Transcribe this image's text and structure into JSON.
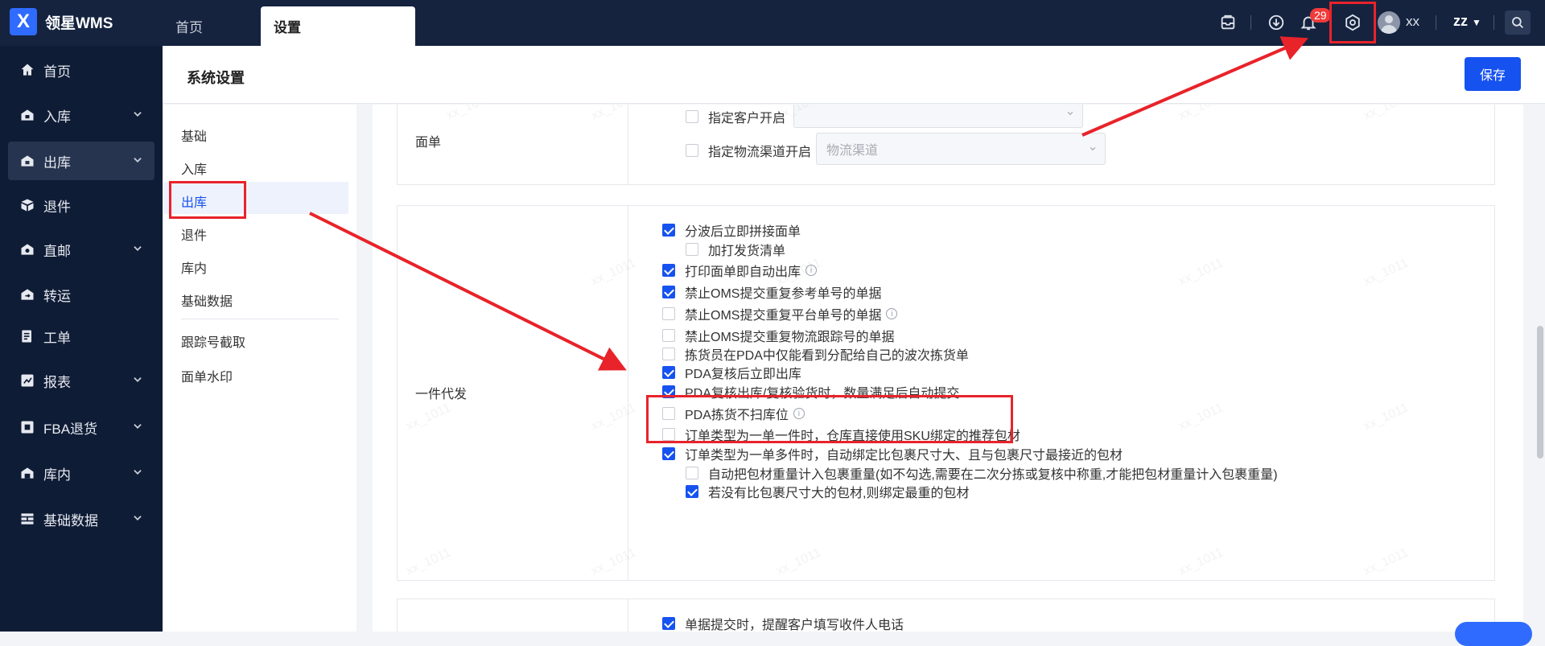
{
  "app": {
    "logo_mark": "X",
    "name": "领星WMS"
  },
  "top_tabs": [
    {
      "label": "首页"
    },
    {
      "label": "设置"
    }
  ],
  "topbar": {
    "notification_count": "29",
    "user_name": "xx",
    "org": "zz",
    "icons": [
      "inbox-icon",
      "download-icon",
      "bell-icon",
      "settings-icon",
      "search-icon"
    ]
  },
  "sidebar": {
    "items": [
      {
        "label": "首页",
        "icon": "home-icon"
      },
      {
        "label": "入库",
        "icon": "inbound-icon"
      },
      {
        "label": "出库",
        "icon": "outbound-icon"
      },
      {
        "label": "退件",
        "icon": "return-icon"
      },
      {
        "label": "直邮",
        "icon": "direct-mail-icon"
      },
      {
        "label": "转运",
        "icon": "transfer-icon"
      },
      {
        "label": "工单",
        "icon": "work-order-icon"
      },
      {
        "label": "报表",
        "icon": "report-icon"
      },
      {
        "label": "FBA退货",
        "icon": "fba-return-icon"
      },
      {
        "label": "库内",
        "icon": "warehouse-icon"
      },
      {
        "label": "基础数据",
        "icon": "base-data-icon"
      }
    ],
    "active": "出库"
  },
  "page": {
    "title": "系统设置",
    "save_label": "保存"
  },
  "subnav": {
    "items": [
      "基础",
      "入库",
      "出库",
      "退件",
      "库内",
      "基础数据",
      "跟踪号截取",
      "面单水印"
    ],
    "active": "出库"
  },
  "section_label_sheet": {
    "label": "面单",
    "options": [
      {
        "label": "指定客户开启",
        "checked": false,
        "select_placeholder": ""
      },
      {
        "label": "指定物流渠道开启",
        "checked": false,
        "select_placeholder": "物流渠道"
      }
    ]
  },
  "section_one_piece": {
    "label": "一件代发",
    "options": [
      {
        "label": "分波后立即拼接面单",
        "checked": true
      },
      {
        "label": "加打发货清单",
        "checked": false
      },
      {
        "label": "打印面单即自动出库",
        "checked": true
      },
      {
        "label": "禁止OMS提交重复参考单号的单据",
        "checked": true
      },
      {
        "label": "禁止OMS提交重复平台单号的单据",
        "checked": false
      },
      {
        "label": "禁止OMS提交重复物流跟踪号的单据",
        "checked": false
      },
      {
        "label": "拣货员在PDA中仅能看到分配给自己的波次拣货单",
        "checked": false
      },
      {
        "label": "PDA复核后立即出库",
        "checked": true
      },
      {
        "label": "PDA复核出库/复核验货时，数量满足后自动提交",
        "checked": true
      },
      {
        "label": "PDA拣货不扫库位",
        "checked": false
      },
      {
        "label": "订单类型为一单一件时，仓库直接使用SKU绑定的推荐包材",
        "checked": false
      },
      {
        "label": "订单类型为一单多件时，自动绑定比包裹尺寸大、且与包裹尺寸最接近的包材",
        "checked": true
      },
      {
        "label": "自动把包材重量计入包裹重量(如不勾选,需要在二次分拣或复核中称重,才能把包材重量计入包裹重量)",
        "checked": false
      },
      {
        "label": "若没有比包裹尺寸大的包材,则绑定最重的包材",
        "checked": true
      }
    ]
  },
  "section_next": {
    "options": [
      {
        "label": "单据提交时，提醒客户填写收件人电话",
        "checked": true
      }
    ]
  },
  "watermark": "xx_1011",
  "info_icon": "i"
}
